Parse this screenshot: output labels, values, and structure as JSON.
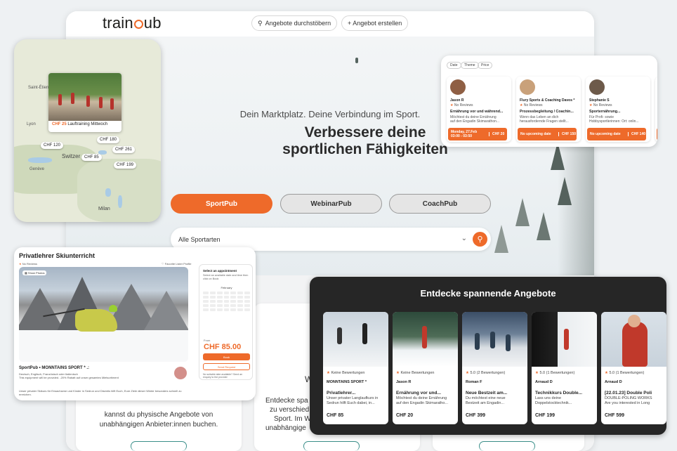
{
  "topbar": {
    "logo": "trainpub",
    "browse_label": "Angebote durchstöbern",
    "create_label": "+ Angebot erstellen"
  },
  "hero": {
    "subtitle": "Dein Marktplatz. Deine Verbindung im Sport.",
    "title_line1": "Verbessere deine",
    "title_line2": "sportlichen Fähigkeiten",
    "tabs": [
      "SportPub",
      "WebinarPub",
      "CoachPub"
    ],
    "search_value": "Alle Sportarten"
  },
  "below": {
    "col1_line1": "kannst du physische Angebote von",
    "col1_line2": "unabhängigen Anbieter:innen buchen.",
    "col2_line1": "Entdecke spa",
    "col2_line2": "zu verschied",
    "col2_line3": "Sport. Im W",
    "col2_line4": "unabhängige",
    "col2_heading_fragment": "W"
  },
  "map": {
    "popup_price": "CHF 25",
    "popup_title": "Lauftraining Mittwoch",
    "tags": [
      "CHF 180",
      "CHF 120",
      "CHF 261",
      "CHF 85",
      "CHF 199"
    ],
    "labels": [
      "Switzer",
      "Milan",
      "Saint-Étienne",
      "Lyon",
      "Genève"
    ]
  },
  "top_right": {
    "filters": [
      "Date",
      "Theme",
      "Price"
    ],
    "cards": [
      {
        "name": "Jason R",
        "reviews": "No Reviews",
        "title": "Ernährung vor und während...",
        "desc1": "Möchtest du deine Ernährung",
        "desc2": "auf den Engadin Skimarathon...",
        "date": "Monday, 27.Feb",
        "time": "03:00 - 03:50",
        "price": "CHF 20"
      },
      {
        "name": "Flury Sports & Coaching Davos *",
        "reviews": "No Reviews",
        "title": "Prozessbegleitung / Coachin...",
        "desc1": "Wenn das Leben an dich",
        "desc2": "herausfordernde Fragen stellt...",
        "date": "No upcoming date",
        "time": "",
        "price": "CHF 150"
      },
      {
        "name": "Stephanie S",
        "reviews": "No Reviews",
        "title": "Sporternährung...",
        "desc1": "Für Profi- sowie",
        "desc2": "Hobbysportlerinnen: Ort: onlin...",
        "date": "No upcoming date",
        "time": "",
        "price": "CHF 140"
      }
    ]
  },
  "detail": {
    "title": "Privatlehrer Skiunterricht",
    "reviews": "No Reviews",
    "favorite": "Favorite Lister Profile",
    "show_photos": "Show Photos",
    "provider": "SportPub • MONNTAINS SPORT * .:",
    "languages": "Deutsch, Englisch, Französisch oder Italienisch",
    "discount": "This equipment will be provided. -20% Rabatt auf unser gesamtes Mietsortiment",
    "description": "Unser privater Skikurs für Erwachsene und Kinder in Sedrun und Disentis hilft Euch, Eure Ziele dieser Winter besonders schnell zu erreichen.",
    "booking": {
      "heading": "Select an appointment",
      "sub": "Select an available date and time then click on Book",
      "month": "February",
      "from": "From",
      "price": "CHF 85.00",
      "book": "Book",
      "send_request": "Send Request",
      "note": "No suitable date available? Send an enquiry to the provider"
    }
  },
  "discover": {
    "heading": "Entdecke spannende Angebote",
    "cards": [
      {
        "reviews": "Keine Bewertungen",
        "provider": "MONNTAINS SPORT *",
        "title": "Privatlehrer...",
        "desc1": "Unser privater Langlaufkurs in",
        "desc2": "Sedrun hilft Euch dabei, in...",
        "price": "CHF 85"
      },
      {
        "reviews": "Keine Bewertungen",
        "provider": "Jason R",
        "title": "Ernährung vor und...",
        "desc1": "Möchtest du deine Ernährung",
        "desc2": "auf den Engadin Skimaratho...",
        "price": "CHF 20"
      },
      {
        "reviews": "5.0 (2 Bewertungen)",
        "provider": "Roman F",
        "title": "Neue Bestzeit am...",
        "desc1": "Du möchtest eine neue",
        "desc2": "Bestzeit am Engadin...",
        "price": "CHF 399"
      },
      {
        "reviews": "5.0 (1 Bewertungen)",
        "provider": "Arnaud D",
        "title": "Technikkurs Double...",
        "desc1": "Lass uns deine",
        "desc2": "Doppelstocktechnik...",
        "price": "CHF 199"
      },
      {
        "reviews": "5.0 (1 Bewertungen)",
        "provider": "Arnaud D",
        "title": "[22.01.23] Double Poli",
        "desc1": "DOUBLE-POLING WORKS",
        "desc2": "Are you interested in Long",
        "price": "CHF 599"
      }
    ]
  },
  "colors": {
    "accent": "#ee6a2a",
    "dark_panel": "#262626"
  }
}
